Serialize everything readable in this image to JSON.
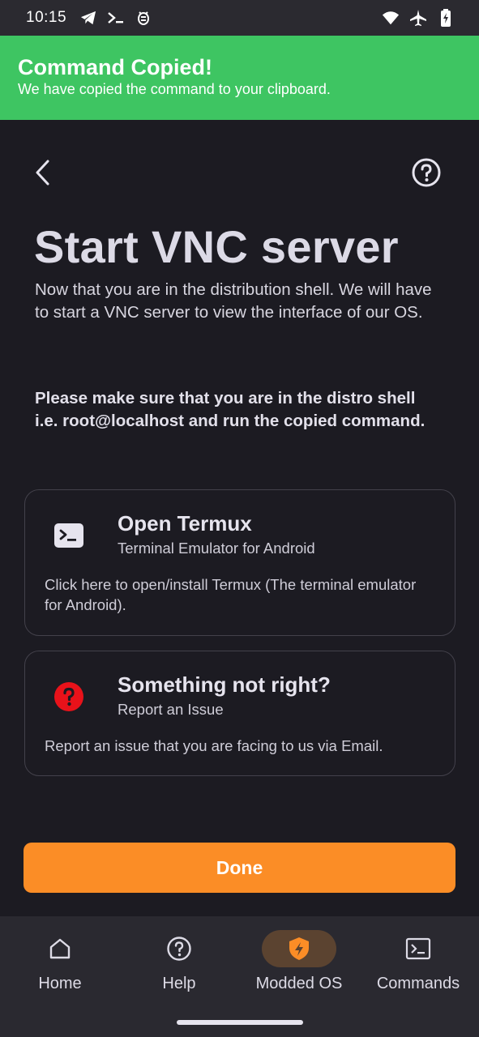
{
  "status_bar": {
    "time": "10:15",
    "left_icons": [
      "telegram-icon",
      "terminal-icon",
      "bug-icon"
    ],
    "right_icons": [
      "wifi-icon",
      "airplane-icon",
      "battery-charging-icon"
    ]
  },
  "toast": {
    "title": "Command Copied!",
    "message": "We have copied the command to your clipboard.",
    "color": "#3ec562"
  },
  "header": {
    "back_icon": "chevron-left-icon",
    "help_icon": "help-circle-icon"
  },
  "page": {
    "title": "Start VNC server",
    "intro": "Now that you are in the distribution shell. We will have to start a VNC server to view the interface of our OS.",
    "notice": "Please make sure that you are in the distro shell i.e. root@localhost and run the copied command."
  },
  "cards": [
    {
      "icon": "terminal-icon",
      "title": "Open Termux",
      "subtitle": "Terminal Emulator for Android",
      "description": "Click here to open/install Termux (The terminal emulator for Android)."
    },
    {
      "icon": "question-icon",
      "icon_color": "#e8121a",
      "title": "Something not right?",
      "subtitle": "Report an Issue",
      "description": "Report an issue that you are facing to us via Email."
    }
  ],
  "done_button": {
    "label": "Done",
    "color": "#fb8d26"
  },
  "bottom_nav": {
    "items": [
      {
        "label": "Home",
        "icon": "home-icon",
        "active": false
      },
      {
        "label": "Help",
        "icon": "help-icon",
        "active": false
      },
      {
        "label": "Modded OS",
        "icon": "shield-bolt-icon",
        "active": true
      },
      {
        "label": "Commands",
        "icon": "terminal-icon",
        "active": false
      }
    ],
    "accent": "#fb8d26"
  }
}
